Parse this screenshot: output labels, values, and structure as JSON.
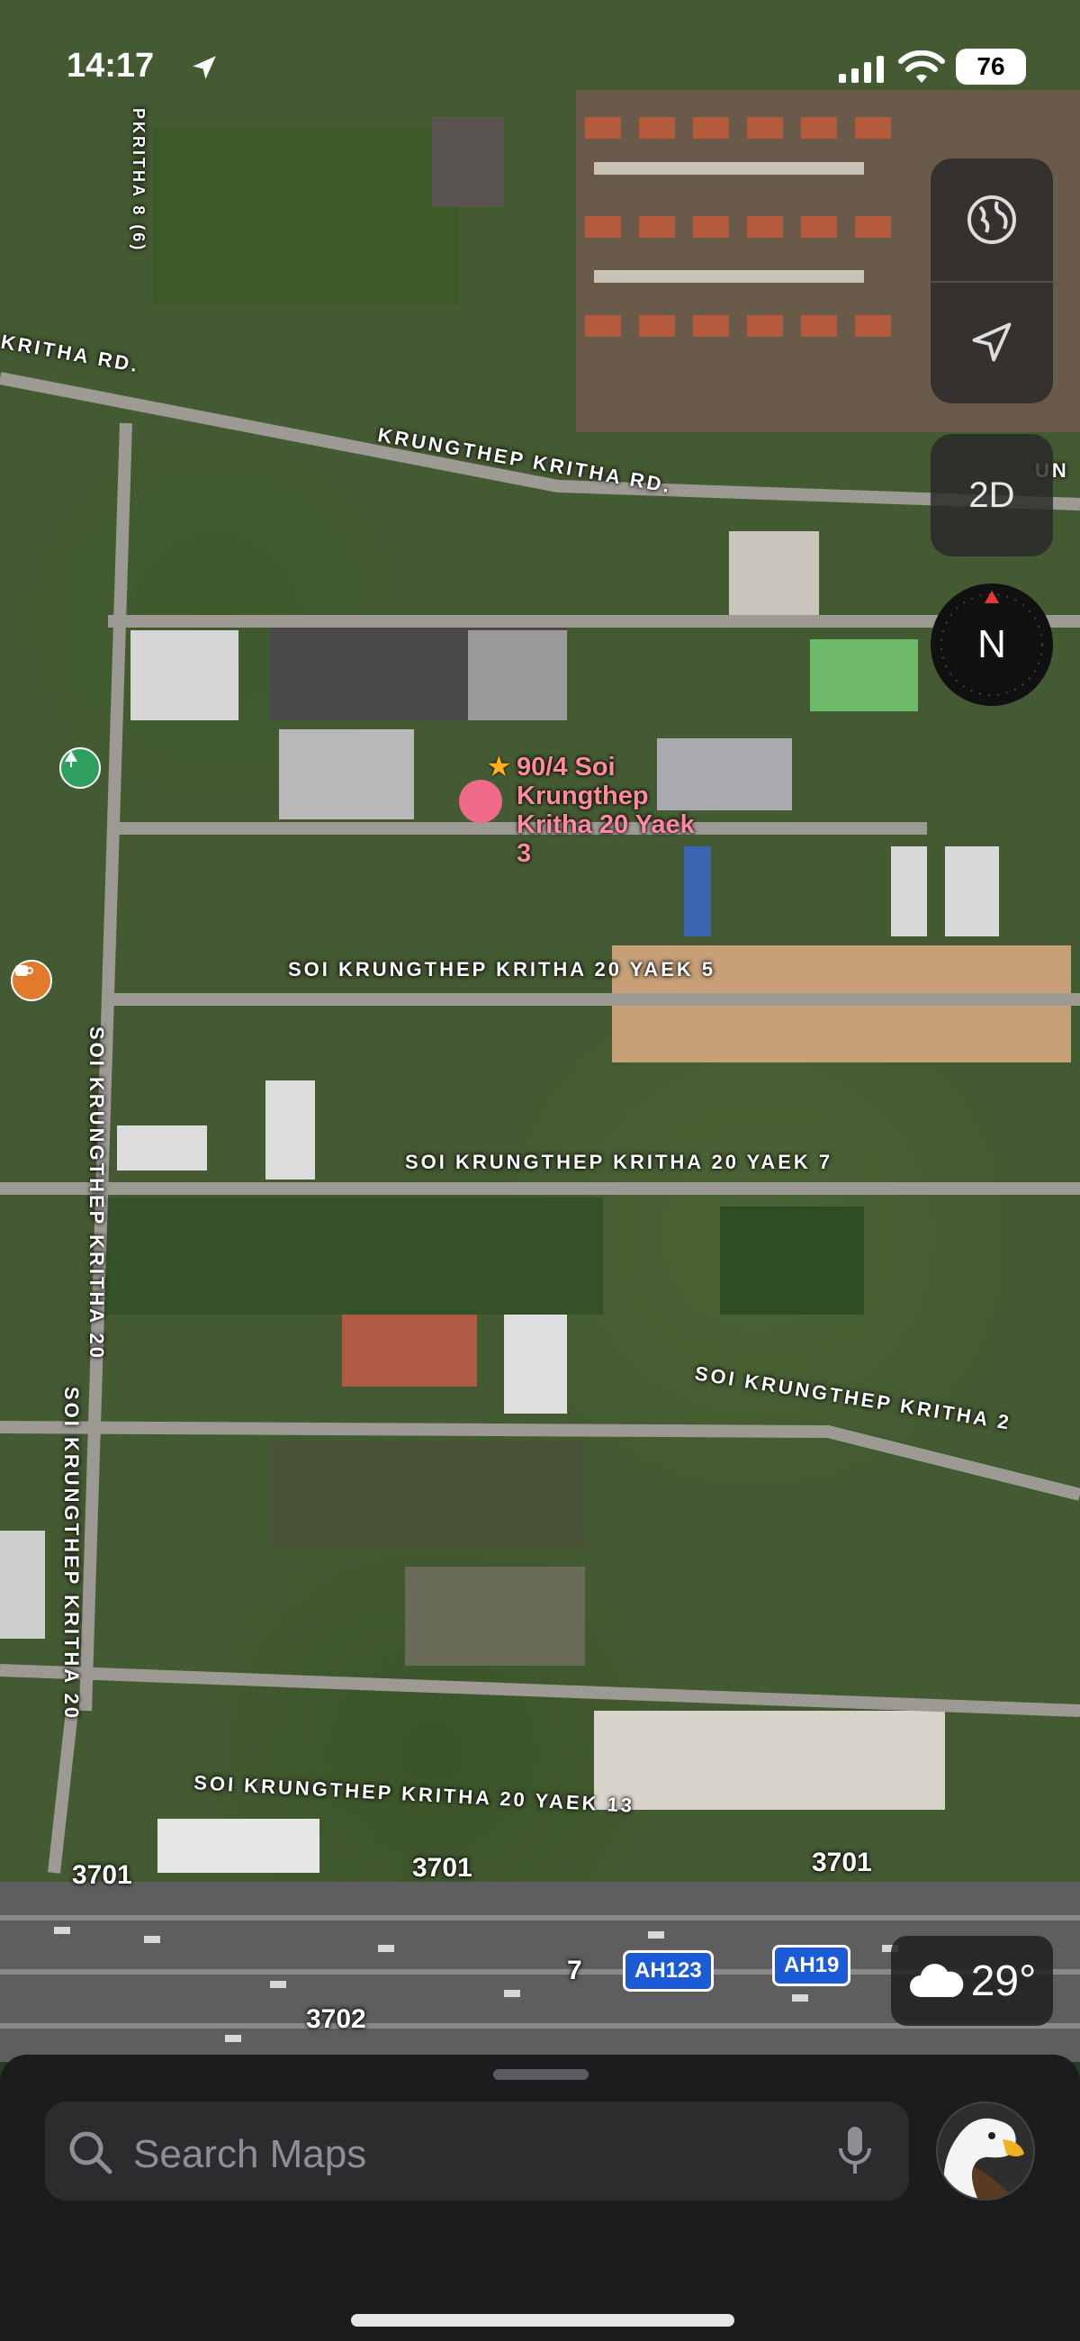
{
  "status_bar": {
    "time": "14:17",
    "battery": "76"
  },
  "map": {
    "road_labels": [
      "KRITHA RD.",
      "KRUNGTHEP KRITHA RD.",
      "UN",
      "SOI KRUNGTHEP KRITHA 20 YAEK 5",
      "SOI KRUNGTHEP KRITHA 20 YAEK 7",
      "SOI KRUNGTHEP KRITHA 20",
      "SOI KRUNGTHEP KRITHA 20 YAEK 13",
      "SOI KRUNGTHEP KRITHA 2",
      "PKRITHA 8 (6)"
    ],
    "vertical_road_left_lower": "SOI KRUNGTHEP KRITHA 20",
    "route_numbers": [
      "3701",
      "3701",
      "3701",
      "3702",
      "7"
    ],
    "highway_badges": [
      "AH123",
      "AH19"
    ],
    "pin": {
      "label": "90/4 Soi Krungthep Kritha 20 Yaek 3",
      "color": "#f06a8a"
    }
  },
  "controls": {
    "globe_icon": "globe-icon",
    "location_icon": "location-arrow-icon",
    "view_mode_label": "2D",
    "compass_label": "N"
  },
  "weather": {
    "icon": "cloud-icon",
    "temperature": "29°"
  },
  "search": {
    "placeholder": "Search Maps"
  }
}
